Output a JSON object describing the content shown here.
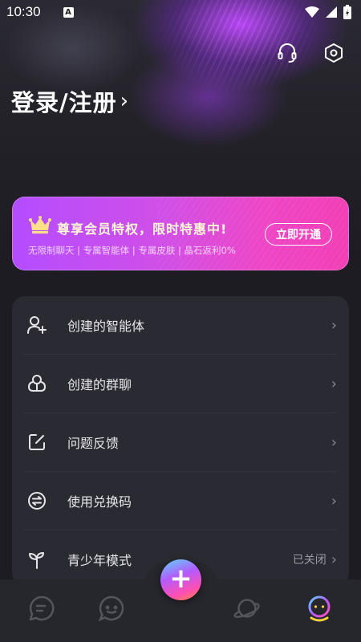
{
  "status_bar": {
    "time": "10:30",
    "notification_letter": "A",
    "icons": [
      "wifi-icon",
      "signal-icon",
      "battery-charging-icon"
    ]
  },
  "header": {
    "icons": [
      "headset-icon",
      "settings-hex-icon"
    ],
    "login_label": "登录/注册",
    "login_chevron": "›"
  },
  "vip_banner": {
    "title": "尊享会员特权，限时特惠中!",
    "subtitle": "无限制聊天 | 专属智能体 | 专属皮肤 | 晶石返利0%",
    "button_label": "立即开通",
    "icon": "crown-icon",
    "colors": {
      "start": "#b44dff",
      "end": "#f23fb6",
      "title": "#fff8d6"
    }
  },
  "menu": {
    "items": [
      {
        "label": "创建的智能体",
        "icon": "add-user-icon",
        "value": ""
      },
      {
        "label": "创建的群聊",
        "icon": "group-icon",
        "value": ""
      },
      {
        "label": "问题反馈",
        "icon": "edit-icon",
        "value": ""
      },
      {
        "label": "使用兑换码",
        "icon": "exchange-icon",
        "value": ""
      },
      {
        "label": "青少年模式",
        "icon": "sprout-icon",
        "value": "已关闭"
      }
    ],
    "chevron": "›"
  },
  "tab_bar": {
    "tabs": [
      {
        "icon": "chat-icon",
        "active": false
      },
      {
        "icon": "discover-icon",
        "active": false
      },
      {
        "icon": "planet-icon",
        "active": false
      },
      {
        "icon": "profile-icon",
        "active": true
      }
    ],
    "fab_label": "+",
    "accent_colors": [
      "#5ad8ff",
      "#b35cff",
      "#ff4fb1",
      "#ffd23c"
    ]
  }
}
